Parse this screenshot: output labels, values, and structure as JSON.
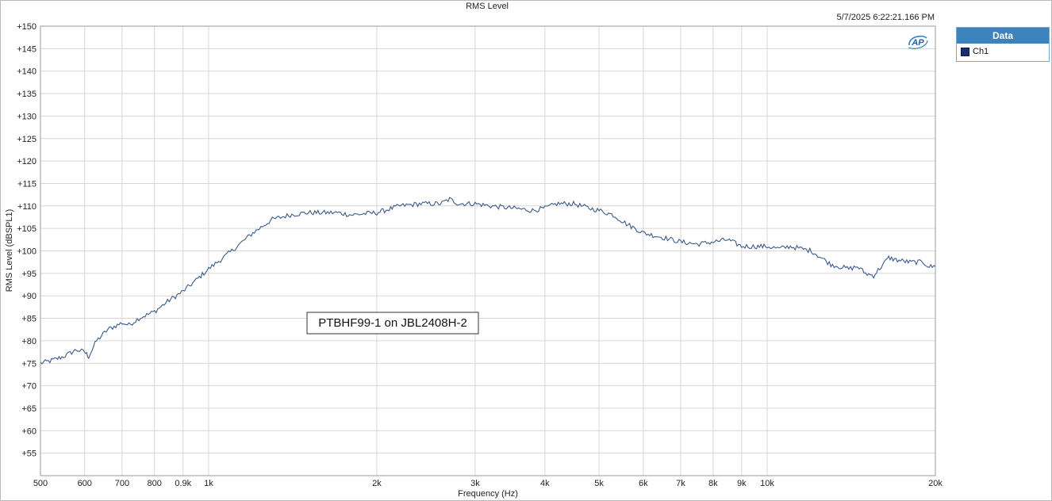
{
  "header": {
    "title": "RMS Level",
    "timestamp": "5/7/2025 6:22:21.166 PM"
  },
  "logo_text": "AP",
  "legend": {
    "title": "Data",
    "entries": [
      {
        "label": "Ch1",
        "color": "#1b2d6e"
      }
    ]
  },
  "annotation": "PTBHF99-1 on JBL2408H-2",
  "chart_data": {
    "type": "line",
    "title": "RMS Level",
    "xlabel": "Frequency (Hz)",
    "ylabel": "RMS Level (dBSPL1)",
    "xscale": "log",
    "xlim": [
      500,
      20000
    ],
    "ylim": [
      50,
      150
    ],
    "grid": true,
    "legend_position": "right-outside-top",
    "x_ticks": [
      {
        "v": 500,
        "label": "500"
      },
      {
        "v": 600,
        "label": "600"
      },
      {
        "v": 700,
        "label": "700"
      },
      {
        "v": 800,
        "label": "800"
      },
      {
        "v": 900,
        "label": "0.9k"
      },
      {
        "v": 1000,
        "label": "1k"
      },
      {
        "v": 2000,
        "label": "2k"
      },
      {
        "v": 3000,
        "label": "3k"
      },
      {
        "v": 4000,
        "label": "4k"
      },
      {
        "v": 5000,
        "label": "5k"
      },
      {
        "v": 6000,
        "label": "6k"
      },
      {
        "v": 7000,
        "label": "7k"
      },
      {
        "v": 8000,
        "label": "8k"
      },
      {
        "v": 9000,
        "label": "9k"
      },
      {
        "v": 10000,
        "label": "10k"
      },
      {
        "v": 20000,
        "label": "20k"
      }
    ],
    "y_ticks": [
      {
        "v": 55,
        "label": "+55"
      },
      {
        "v": 60,
        "label": "+60"
      },
      {
        "v": 65,
        "label": "+65"
      },
      {
        "v": 70,
        "label": "+70"
      },
      {
        "v": 75,
        "label": "+75"
      },
      {
        "v": 80,
        "label": "+80"
      },
      {
        "v": 85,
        "label": "+85"
      },
      {
        "v": 90,
        "label": "+90"
      },
      {
        "v": 95,
        "label": "+95"
      },
      {
        "v": 100,
        "label": "+100"
      },
      {
        "v": 105,
        "label": "+105"
      },
      {
        "v": 110,
        "label": "+110"
      },
      {
        "v": 115,
        "label": "+115"
      },
      {
        "v": 120,
        "label": "+120"
      },
      {
        "v": 125,
        "label": "+125"
      },
      {
        "v": 130,
        "label": "+130"
      },
      {
        "v": 135,
        "label": "+135"
      },
      {
        "v": 140,
        "label": "+140"
      },
      {
        "v": 145,
        "label": "+145"
      },
      {
        "v": 150,
        "label": "+150"
      }
    ],
    "series": [
      {
        "name": "Ch1",
        "color": "#3a5a8c",
        "x": [
          500,
          520,
          550,
          580,
          600,
          610,
          630,
          660,
          700,
          720,
          750,
          800,
          850,
          900,
          950,
          1000,
          1050,
          1100,
          1200,
          1300,
          1400,
          1500,
          1600,
          1700,
          1800,
          2000,
          2200,
          2400,
          2600,
          2700,
          2800,
          3000,
          3200,
          3500,
          3800,
          4000,
          4200,
          4500,
          4800,
          5000,
          5300,
          5600,
          6000,
          6500,
          7000,
          7500,
          8000,
          8500,
          9000,
          9500,
          10000,
          10500,
          11000,
          12000,
          13000,
          14000,
          14500,
          15000,
          15500,
          16000,
          16500,
          17000,
          18000,
          19000,
          19500,
          20000
        ],
        "y": [
          75,
          75.5,
          76.5,
          78,
          77.5,
          76.5,
          80,
          82.5,
          84,
          83.5,
          85,
          86.5,
          89,
          91,
          93.5,
          96,
          98,
          100,
          104,
          107,
          108,
          108.5,
          108.5,
          108.5,
          108,
          108.5,
          110,
          110.5,
          110.5,
          111.5,
          110.5,
          110.5,
          110,
          109.5,
          109,
          109.5,
          110.5,
          110.5,
          109.5,
          109,
          108,
          106,
          104,
          103,
          102,
          101.5,
          102,
          102.5,
          101,
          101,
          101,
          100.5,
          101,
          100,
          97,
          96,
          96.5,
          95,
          94.5,
          96.5,
          98.5,
          98,
          97.5,
          97.5,
          96.5,
          96.5
        ]
      }
    ]
  }
}
